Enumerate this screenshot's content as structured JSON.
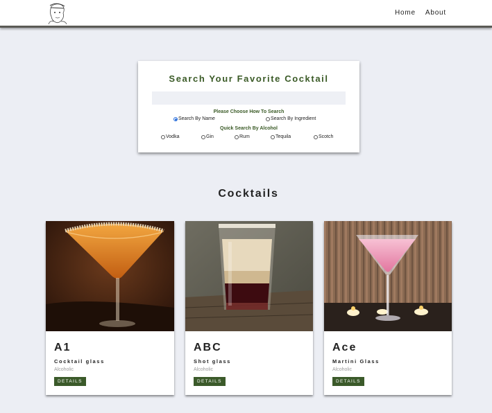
{
  "nav": {
    "home": "Home",
    "about": "About",
    "logo_icon": "portrait-sketch-logo"
  },
  "search": {
    "title": "Search Your Favorite Cocktail",
    "input_value": "",
    "choose_label": "Please Choose How To Search",
    "by_name": "Search By Name",
    "by_ingredient": "Search By Ingredient",
    "selected": "Search By Name",
    "quick_label": "Quick Search By Alcohol",
    "alcohols": [
      "Vodka",
      "Gin",
      "Rum",
      "Tequila",
      "Scotch"
    ]
  },
  "section_title": "Cocktails",
  "cards": [
    {
      "name": "A1",
      "glass": "Cocktail glass",
      "type": "Alcoholic",
      "button": "DETAILS"
    },
    {
      "name": "ABC",
      "glass": "Shot glass",
      "type": "Alcoholic",
      "button": "DETAILS"
    },
    {
      "name": "Ace",
      "glass": "Martini Glass",
      "type": "Alcoholic",
      "button": "DETAILS"
    }
  ],
  "colors": {
    "accent_green": "#3b5a2a",
    "title_green": "#3a5a26",
    "page_bg": "#eceef4"
  }
}
